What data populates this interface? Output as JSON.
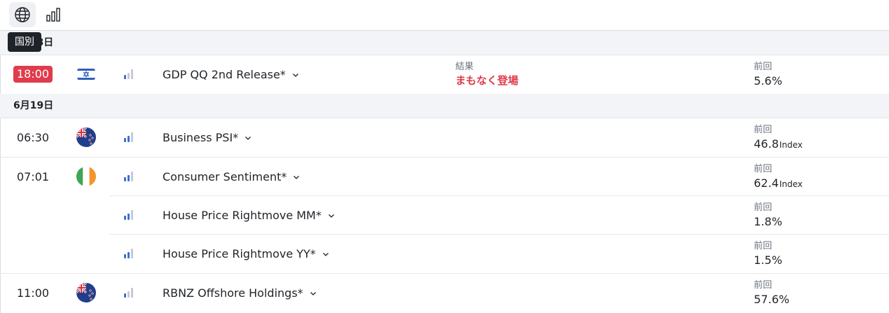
{
  "toolbar": {
    "tooltip": "国別",
    "buttons": [
      {
        "icon": "globe-icon",
        "active": true
      },
      {
        "icon": "bar-chart-icon",
        "active": false
      }
    ]
  },
  "colors": {
    "accent_red": "#e03c4c",
    "importance_high": "#3b6fd4",
    "importance_low": "#c5cad3"
  },
  "groups": [
    {
      "date": "6月18日",
      "events": [
        {
          "time": "18:00",
          "live": true,
          "flag": "israel-flag-icon",
          "importance": 1,
          "name": "GDP QQ 2nd Release*",
          "result_label": "結果",
          "result_value": "まもなく登場",
          "prev_label": "前回",
          "prev_value": "5.6%",
          "prev_unit": ""
        }
      ]
    },
    {
      "date": "6月19日",
      "events": [
        {
          "time": "06:30",
          "live": false,
          "flag": "new-zealand-flag-icon",
          "importance": 2,
          "name": "Business PSI*",
          "prev_label": "前回",
          "prev_value": "46.8",
          "prev_unit": "Index"
        },
        {
          "time": "07:01",
          "live": false,
          "flag": "ireland-flag-icon",
          "importance": 2,
          "name": "Consumer Sentiment*",
          "prev_label": "前回",
          "prev_value": "62.4",
          "prev_unit": "Index"
        },
        {
          "time": "",
          "live": false,
          "flag": "",
          "importance": 2,
          "name": "House Price Rightmove MM*",
          "prev_label": "前回",
          "prev_value": "1.8%",
          "prev_unit": ""
        },
        {
          "time": "",
          "live": false,
          "flag": "",
          "importance": 2,
          "name": "House Price Rightmove YY*",
          "prev_label": "前回",
          "prev_value": "1.5%",
          "prev_unit": ""
        },
        {
          "time": "11:00",
          "live": false,
          "flag": "new-zealand-flag-icon",
          "importance": 1,
          "name": "RBNZ Offshore Holdings*",
          "prev_label": "前回",
          "prev_value": "57.6%",
          "prev_unit": ""
        }
      ]
    }
  ]
}
